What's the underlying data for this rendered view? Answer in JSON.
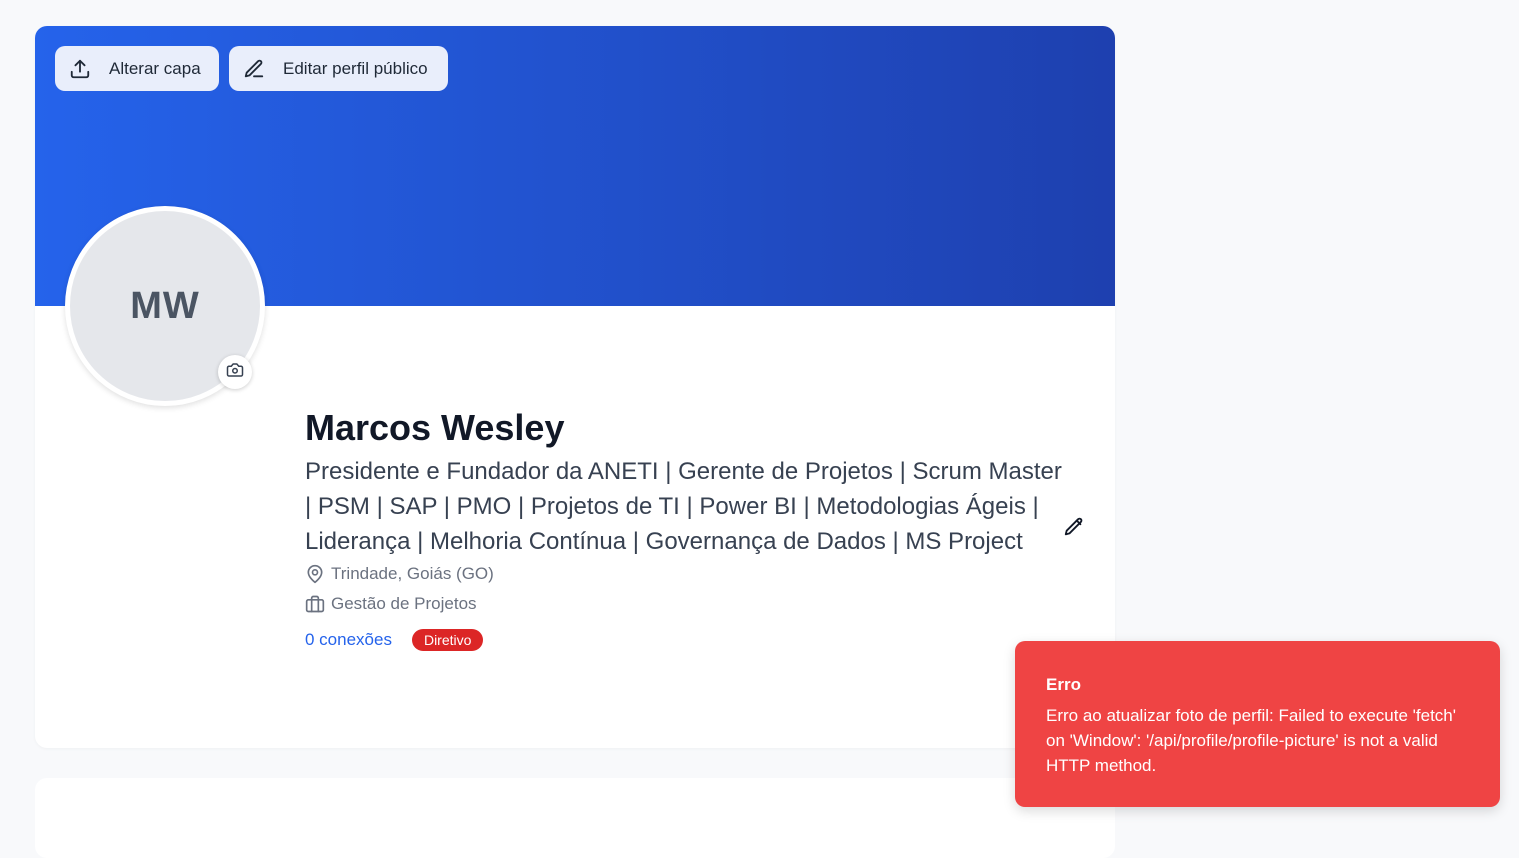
{
  "cover": {
    "change_cover_label": "Alterar capa",
    "edit_profile_label": "Editar perfil público",
    "gradient_start": "#2563eb",
    "gradient_end": "#1e40af"
  },
  "profile": {
    "initials": "MW",
    "name": "Marcos Wesley",
    "headline": "Presidente e Fundador da ANETI | Gerente de Projetos | Scrum Master | PSM | SAP | PMO | Projetos de TI | Power BI | Metodologias Ágeis | Liderança | Melhoria Contínua | Governança de Dados | MS Project",
    "location": "Trindade, Goiás (GO)",
    "area": "Gestão de Projetos",
    "connections": "0 conexões",
    "badge": "Diretivo"
  },
  "toast": {
    "title": "Erro",
    "message": "Erro ao atualizar foto de perfil: Failed to execute 'fetch' on 'Window': '/api/profile/profile-picture' is not a valid HTTP method.",
    "color": "#ef4444"
  },
  "icons": {
    "upload": "upload-icon",
    "edit": "pencil-icon",
    "camera": "camera-icon",
    "location": "map-pin-icon",
    "briefcase": "briefcase-icon"
  }
}
